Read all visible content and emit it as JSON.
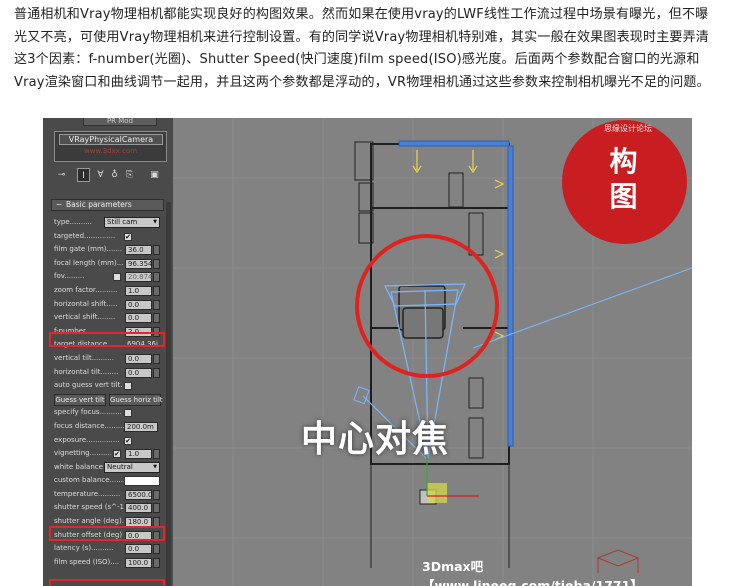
{
  "article": {
    "paragraph": "普通相机和Vray物理相机都能实现良好的构图效果。然而如果在使用vray的LWF线性工作流过程中场景有曝光，但不曝光又不亮，可使用Vray物理相机来进行控制设置。有的同学说Vray物理相机特别难，其实一般在效果图表现时主要弄清这3个因素：f-number(光圈)、Shutter Speed(快门速度)film speed(ISO)感光度。后面两个参数配合窗口的光源和Vray渲染窗口和曲线调节一起用，并且这两个参数都是浮动的，VR物理相机通过这些参数来控制相机曝光不足的问题。"
  },
  "panel": {
    "top_tab": "PR Mod",
    "camera_name": "VRayPhysicalCamera",
    "camera_watermark": "www.3dxx.com",
    "rollout_title": "Basic parameters",
    "params": [
      {
        "label": "type..........",
        "kind": "dropdown",
        "value": "Still cam"
      },
      {
        "label": "targeted..............",
        "kind": "check",
        "checked": "✔"
      },
      {
        "label": "film gate (mm).......",
        "kind": "value",
        "value": "36.0"
      },
      {
        "label": "focal length (mm)...",
        "kind": "value",
        "value": "96.354"
      },
      {
        "label": "fov.........",
        "kind": "checkvalue",
        "value": "20.874"
      },
      {
        "label": "zoom factor..........",
        "kind": "value",
        "value": "1.0"
      },
      {
        "label": "horizontal shift.....",
        "kind": "value",
        "value": "0.0"
      },
      {
        "label": "vertical shift........",
        "kind": "value",
        "value": "0.0"
      },
      {
        "label": "f-number............",
        "kind": "value",
        "value": "2.0"
      },
      {
        "label": "target distance.......",
        "kind": "text",
        "value": "6904.36i"
      },
      {
        "label": "vertical tilt..........",
        "kind": "value",
        "value": "0.0"
      },
      {
        "label": "horizontal tilt........",
        "kind": "value",
        "value": "0.0"
      },
      {
        "label": "auto guess vert tilt.",
        "kind": "check",
        "checked": ""
      },
      {
        "label": "",
        "kind": "buttons",
        "b1": "Guess vert tilt",
        "b2": "Guess horiz tilt"
      },
      {
        "label": "specify focus..........",
        "kind": "check",
        "checked": ""
      },
      {
        "label": "focus distance..........",
        "kind": "wide",
        "value": "200.0m"
      },
      {
        "label": "exposure...............",
        "kind": "check",
        "checked": "✔"
      },
      {
        "label": "vignetting..........",
        "kind": "checkvalue2",
        "value": "1.0"
      },
      {
        "label": "white balance",
        "kind": "dropdown2",
        "value": "Neutral"
      },
      {
        "label": "custom balance.......",
        "kind": "swatch"
      },
      {
        "label": "temperature..........",
        "kind": "value",
        "value": "6500.0"
      },
      {
        "label": "shutter speed (s^-1",
        "kind": "value",
        "value": "400.0"
      },
      {
        "label": "shutter angle (deg).",
        "kind": "value",
        "value": "180.0"
      },
      {
        "label": "shutter offset (deg)",
        "kind": "value",
        "value": "0.0"
      },
      {
        "label": "latency (s)..........",
        "kind": "value",
        "value": "0.0"
      },
      {
        "label": "film speed (ISO)....",
        "kind": "value",
        "value": "100.0"
      }
    ]
  },
  "viewport": {
    "corner_badge_line1": "构",
    "corner_badge_line2": "图",
    "site_watermark": "思缘设计论坛",
    "focus_caption": "中心对焦",
    "bottom_watermark": "3Dmax吧【www.lineeg.com/tieba/1771】"
  },
  "colors": {
    "highlight": "#e4262a",
    "badge": "#c91e21",
    "frustum": "#7ab8ff",
    "wall_markers": "#e8d44d"
  }
}
